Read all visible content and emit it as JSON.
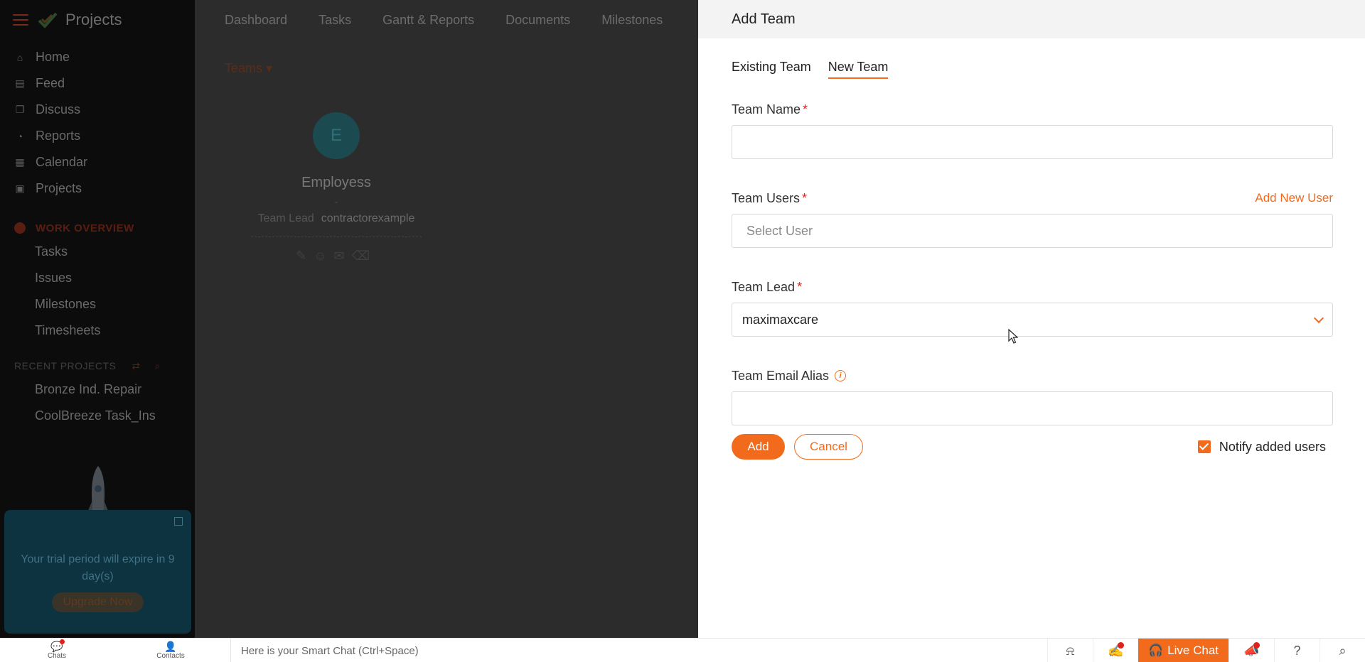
{
  "colors": {
    "accent": "#f26a1b",
    "required": "#e0201a"
  },
  "sidebar": {
    "brand": "Projects",
    "nav": [
      {
        "label": "Home",
        "icon": "home-icon"
      },
      {
        "label": "Feed",
        "icon": "feed-icon"
      },
      {
        "label": "Discuss",
        "icon": "discuss-icon"
      },
      {
        "label": "Reports",
        "icon": "reports-icon"
      },
      {
        "label": "Calendar",
        "icon": "calendar-icon"
      },
      {
        "label": "Projects",
        "icon": "projects-icon"
      }
    ],
    "work_overview": {
      "title": "WORK OVERVIEW",
      "items": [
        "Tasks",
        "Issues",
        "Milestones",
        "Timesheets"
      ]
    },
    "recent_projects": {
      "title": "RECENT PROJECTS",
      "items": [
        "Bronze Ind. Repair",
        "CoolBreeze Task_Ins"
      ]
    },
    "trial": {
      "text": "Your trial period will expire in 9 day(s)",
      "button": "Upgrade Now"
    }
  },
  "main": {
    "tabs": [
      "Dashboard",
      "Tasks",
      "Gantt & Reports",
      "Documents",
      "Milestones"
    ],
    "teams_dropdown": "Teams",
    "team_card": {
      "avatar_letter": "E",
      "name": "Employess",
      "dash": "-",
      "lead_label": "Team Lead",
      "lead_value": "contractorexample"
    }
  },
  "drawer": {
    "title": "Add Team",
    "tabs": [
      {
        "label": "Existing Team",
        "active": false
      },
      {
        "label": "New Team",
        "active": true
      }
    ],
    "fields": {
      "team_name": {
        "label": "Team Name",
        "required": "*",
        "value": ""
      },
      "team_users": {
        "label": "Team Users",
        "required": "*",
        "placeholder": "Select User",
        "link": "Add New User"
      },
      "team_lead": {
        "label": "Team Lead",
        "required": "*",
        "value": "maximaxcare"
      },
      "team_email": {
        "label": "Team Email Alias",
        "value": "",
        "info_icon": "i"
      }
    },
    "actions": {
      "add": "Add",
      "cancel": "Cancel",
      "notify_label": "Notify added users",
      "notify_checked": true
    }
  },
  "bottombar": {
    "chats": "Chats",
    "contacts": "Contacts",
    "smart_chat_placeholder": "Here is your Smart Chat (Ctrl+Space)",
    "live_chat": "Live Chat"
  }
}
